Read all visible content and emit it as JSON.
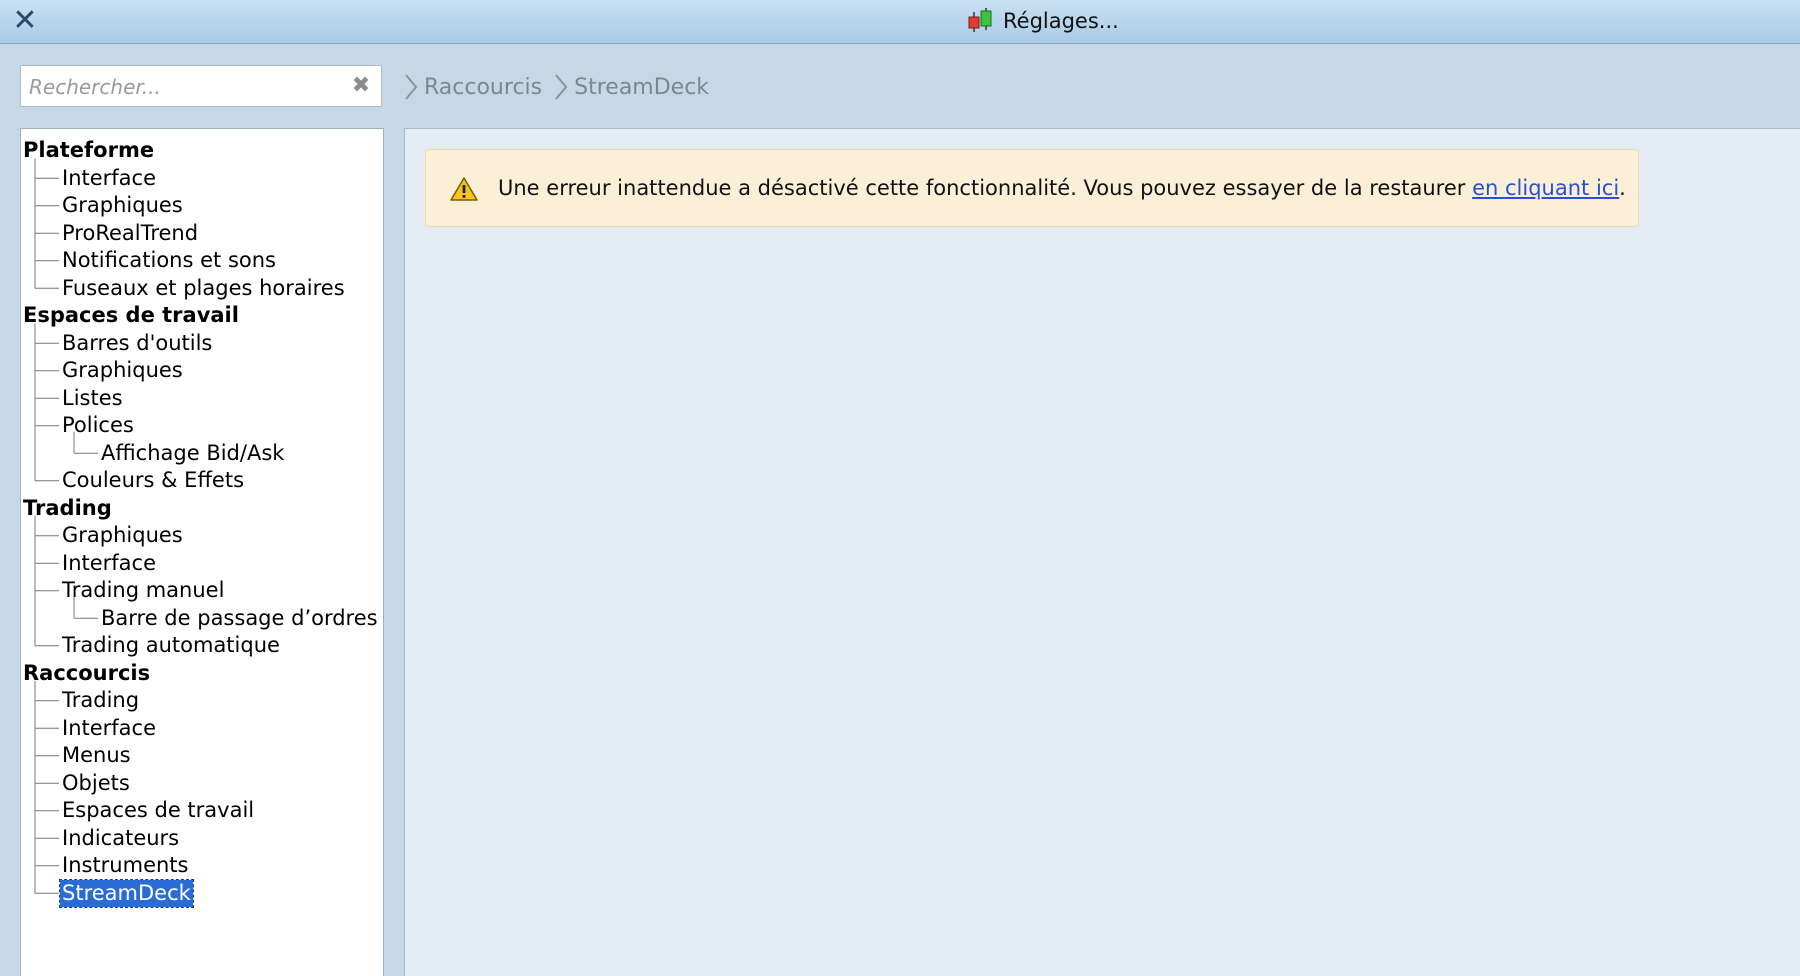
{
  "window": {
    "title": "Réglages...",
    "close_symbol": "✕",
    "app_icon": "candlestick-chart-icon"
  },
  "search": {
    "placeholder": "Rechercher...",
    "value": "",
    "clear_symbol": "✖"
  },
  "breadcrumb": [
    "Raccourcis",
    "StreamDeck"
  ],
  "tree": {
    "items": [
      {
        "label": "Plateforme",
        "level": 0
      },
      {
        "label": "Interface",
        "level": 1
      },
      {
        "label": "Graphiques",
        "level": 1
      },
      {
        "label": "ProRealTrend",
        "level": 1
      },
      {
        "label": "Notifications et sons",
        "level": 1
      },
      {
        "label": "Fuseaux et plages horaires",
        "level": 1
      },
      {
        "label": "Espaces de travail",
        "level": 0
      },
      {
        "label": "Barres d'outils",
        "level": 1
      },
      {
        "label": "Graphiques",
        "level": 1
      },
      {
        "label": "Listes",
        "level": 1
      },
      {
        "label": "Polices",
        "level": 1
      },
      {
        "label": "Affichage Bid/Ask",
        "level": 2
      },
      {
        "label": "Couleurs & Effets",
        "level": 1
      },
      {
        "label": "Trading",
        "level": 0
      },
      {
        "label": "Graphiques",
        "level": 1
      },
      {
        "label": "Interface",
        "level": 1
      },
      {
        "label": "Trading manuel",
        "level": 1
      },
      {
        "label": "Barre de passage d’ordres",
        "level": 2
      },
      {
        "label": "Trading automatique",
        "level": 1
      },
      {
        "label": "Raccourcis",
        "level": 0
      },
      {
        "label": "Trading",
        "level": 1
      },
      {
        "label": "Interface",
        "level": 1
      },
      {
        "label": "Menus",
        "level": 1
      },
      {
        "label": "Objets",
        "level": 1
      },
      {
        "label": "Espaces de travail",
        "level": 1
      },
      {
        "label": "Indicateurs",
        "level": 1
      },
      {
        "label": "Instruments",
        "level": 1
      },
      {
        "label": "StreamDeck",
        "level": 1,
        "selected": true
      }
    ]
  },
  "alert": {
    "icon": "warning-icon",
    "message": "Une erreur inattendue a désactivé cette fonctionnalité. Vous pouvez essayer de la restaurer ",
    "link_text": "en cliquant ici",
    "suffix": "."
  },
  "colors": {
    "selection": "#2a6cd6",
    "alert_background": "#fcefd8",
    "link": "#2552d4",
    "warning": "#f5c518"
  }
}
